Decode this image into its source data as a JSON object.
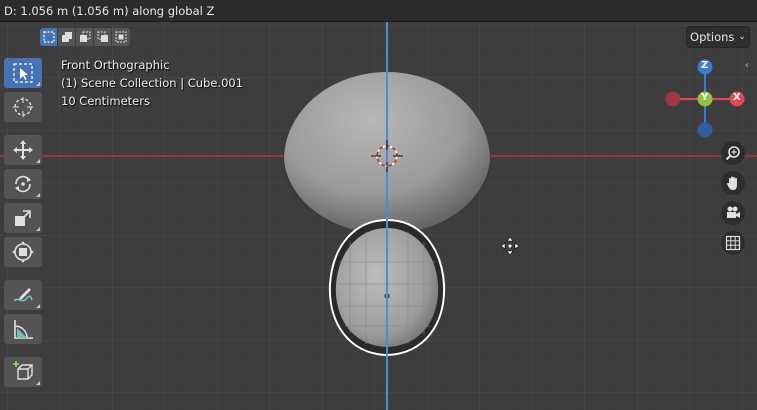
{
  "header": {
    "status_text": "D: 1.056 m (1.056 m) along global Z"
  },
  "viewport": {
    "view_name": "Front Orthographic",
    "collection_info": "(1) Scene Collection | Cube.001",
    "grid_scale": "10 Centimeters",
    "options_label": "Options",
    "colors": {
      "background": "#3d3d3d",
      "x_axis": "#b5363f",
      "z_axis": "#4a8fd6",
      "selection_outline": "#ffffff",
      "active_tool": "#4772b3"
    }
  },
  "selection_modes": [
    {
      "icon": "select-new-icon",
      "active": true
    },
    {
      "icon": "select-extend-icon",
      "active": false
    },
    {
      "icon": "select-subtract-icon",
      "active": false
    },
    {
      "icon": "select-invert-icon",
      "active": false
    },
    {
      "icon": "select-intersect-icon",
      "active": false
    }
  ],
  "toolbar": {
    "tools": [
      "select-box-icon",
      "cursor-icon",
      "move-icon",
      "rotate-icon",
      "scale-icon",
      "transform-icon",
      "annotate-icon",
      "measure-icon",
      "add-cube-icon"
    ]
  },
  "gizmo": {
    "x_label": "X",
    "y_label": "Y",
    "z_label": "Z",
    "x_color": "#e04a56",
    "y_color": "#8bc43f",
    "z_color": "#3a7dd6"
  },
  "navigation": [
    "zoom-icon",
    "pan-hand-icon",
    "camera-icon",
    "grid-icon"
  ]
}
